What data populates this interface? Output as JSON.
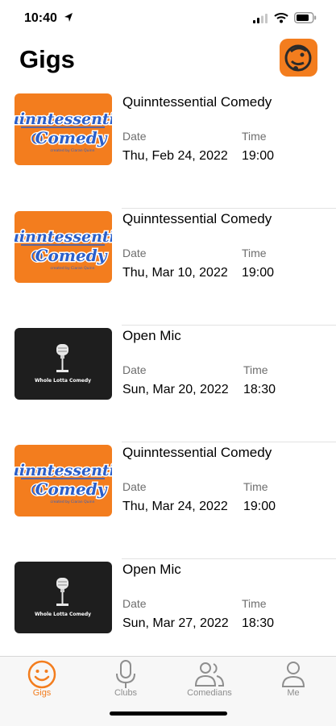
{
  "status": {
    "time": "10:40"
  },
  "header": {
    "title": "Gigs"
  },
  "gigs": [
    {
      "title": "Quinntessential Comedy",
      "date_label": "Date",
      "time_label": "Time",
      "date": "Thu, Feb 24, 2022",
      "time": "19:00",
      "image": "quinntessential-logo"
    },
    {
      "title": "Quinntessential Comedy",
      "date_label": "Date",
      "time_label": "Time",
      "date": "Thu, Mar 10, 2022",
      "time": "19:00",
      "image": "quinntessential-logo"
    },
    {
      "title": "Open Mic",
      "date_label": "Date",
      "time_label": "Time",
      "date": "Sun, Mar 20, 2022",
      "time": "18:30",
      "image": "whole-lotta-comedy-logo"
    },
    {
      "title": "Quinntessential Comedy",
      "date_label": "Date",
      "time_label": "Time",
      "date": "Thu, Mar 24, 2022",
      "time": "19:00",
      "image": "quinntessential-logo"
    },
    {
      "title": "Open Mic",
      "date_label": "Date",
      "time_label": "Time",
      "date": "Sun, Mar 27, 2022",
      "time": "18:30",
      "image": "whole-lotta-comedy-logo"
    }
  ],
  "tabs": [
    {
      "label": "Gigs",
      "icon": "smiley-icon",
      "active": true
    },
    {
      "label": "Clubs",
      "icon": "microphone-icon",
      "active": false
    },
    {
      "label": "Comedians",
      "icon": "people-icon",
      "active": false
    },
    {
      "label": "Me",
      "icon": "person-icon",
      "active": false
    }
  ],
  "colors": {
    "accent": "#f37d1e",
    "logo_blue": "#2b5fc9",
    "dark_thumb": "#1e1e1e",
    "inactive_tab": "#8e8e8e"
  },
  "logos": {
    "quinntessential": {
      "line1": "Quinntessential",
      "line2": "Comedy",
      "tagline": "created by Ciaran Quinn"
    },
    "whole_lotta": {
      "text": "Whole Lotta Comedy"
    }
  }
}
